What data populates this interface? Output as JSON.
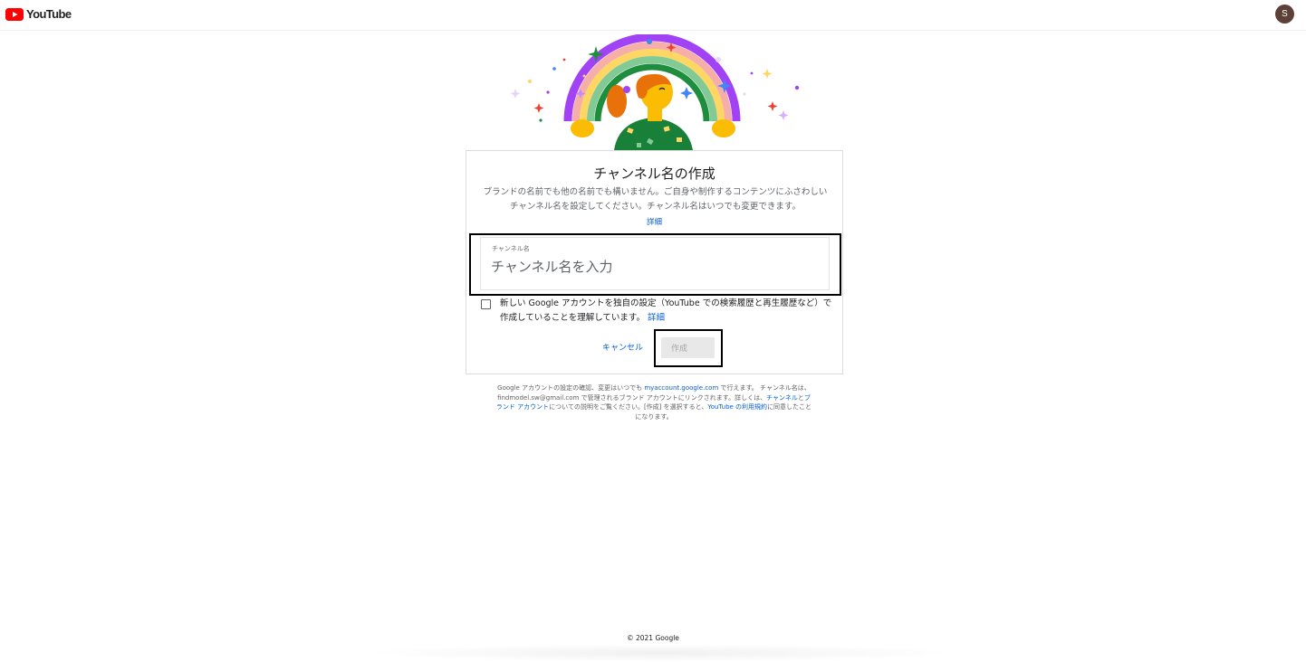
{
  "header": {
    "logo_text": "YouTube",
    "avatar_initial": "S",
    "brand_color": "#ff0000"
  },
  "illustration": {
    "icon": "rainbow-person-illustration"
  },
  "dialog": {
    "title": "チャンネル名の作成",
    "description": "ブランドの名前でも他の名前でも構いません。ご自身や制作するコンテンツにふさわしいチャンネル名を設定してください。チャンネル名はいつでも変更できます。",
    "learn_more": "詳細",
    "field": {
      "label": "チャンネル名",
      "value": "",
      "placeholder": "チャンネル名を入力"
    },
    "checkbox": {
      "checked": false,
      "text": "新しい Google アカウントを独自の設定（YouTube での検索履歴と再生履歴など）で作成していることを理解しています。",
      "link": "詳細"
    },
    "cancel_label": "キャンセル",
    "create_label": "作成"
  },
  "footnote": {
    "part1": "Google アカウントの設定の確認、変更はいつでも ",
    "account_link": "myaccount.google.com",
    "part2": " で行えます。 チャンネル名は、findmodel.sw@gmail.com で管理されるブランド アカウントにリンクされます。詳しくは、",
    "channels_link": "チャンネル",
    "and": "と",
    "brand_link": "ブランド アカウント",
    "part3": "についての説明をご覧ください。[作成] を選択すると、",
    "terms_link": "YouTube の利用規約",
    "part4": "に同意したことになります。"
  },
  "copyright": "© 2021 Google"
}
